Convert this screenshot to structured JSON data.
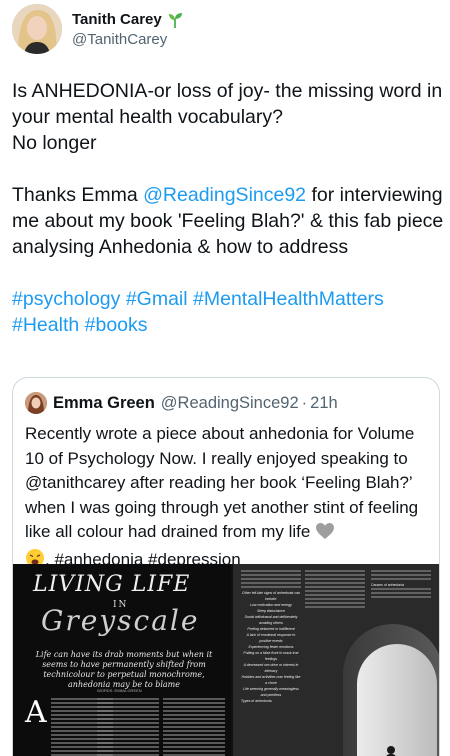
{
  "author": {
    "display_name": "Tanith Carey",
    "handle": "@TanithCarey"
  },
  "tweet": {
    "line1": "Is ANHEDONIA-or loss of joy- the missing word in your mental health vocabulary?",
    "line2": "No longer",
    "thanks_prefix": "Thanks Emma ",
    "thanks_mention": "@ReadingSince92",
    "thanks_suffix": " for interviewing me about my book 'Feeling Blah?' & this fab piece analysing Anhedonia & how to address",
    "hashtags_line1": [
      "#psychology",
      "#Gmail",
      "#MentalHealthMatters"
    ],
    "hashtags_line2": [
      "#Health",
      "#books"
    ]
  },
  "quote": {
    "name": "Emma Green",
    "handle": "@ReadingSince92",
    "separator": "·",
    "time": "21h",
    "text_main": "Recently wrote a piece about anhedonia for Volume 10 of Psychology Now. I really enjoyed speaking to @tanithcarey after reading her book ‘Feeling Blah?’ when I was going through yet another stint of feeling like all colour had drained from my life ",
    "text_tail": ". #anhedonia #depression",
    "emoji1_icon": "grey-heart-icon",
    "emoji2_icon": "weary-face-icon"
  },
  "magazine": {
    "title": "LIVING LIFE",
    "in": "IN",
    "script": "Greyscale",
    "subtitle": "Life can have its drab moments but when it seems to have permanently shifted from technicolour to perpetual monochrome, anhedonia may be to blame",
    "byline": "WORDS: EMMA GREEN",
    "dropcap": "A",
    "list_title": "Other tell-tale signs of anhedonia can include:",
    "list_items": [
      "Low motivation and energy",
      "Sleep disturbance",
      "Social withdrawal and deliberately avoiding others",
      "Feeling detached or indifferent",
      "A lack of emotional response to positive events",
      "Experiencing fewer emotions",
      "Putting on a false front to mask true feelings",
      "A decreased sex drive or interest in intimacy",
      "Hobbies and activities now feeling like a chore",
      "Life seeming generally meaningless and pointless"
    ],
    "causes_title": "Causes of anhedonia",
    "types_title": "Types of anhedonia"
  },
  "colors": {
    "link": "#1d9bf0",
    "text": "#0f1419",
    "secondary": "#536471",
    "border": "#cfd9de"
  }
}
